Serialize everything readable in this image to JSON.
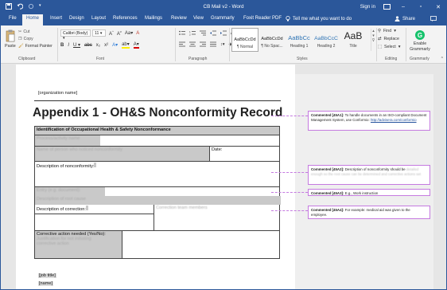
{
  "titlebar": {
    "title": "CB Mail v2  -  Word",
    "signin": "Sign in"
  },
  "tabs": [
    "File",
    "Home",
    "Insert",
    "Design",
    "Layout",
    "References",
    "Mailings",
    "Review",
    "View",
    "Grammarly",
    "Foxit Reader PDF"
  ],
  "active_tab": "Home",
  "tellme": "Tell me what you want to do",
  "share": "Share",
  "ribbon": {
    "clipboard": {
      "paste": "Paste",
      "cut": "Cut",
      "copy": "Copy",
      "format_painter": "Format Painter",
      "label": "Clipboard"
    },
    "font": {
      "name": "Calibri (Body)",
      "size": "11",
      "label": "Font"
    },
    "paragraph": {
      "label": "Paragraph"
    },
    "styles": {
      "label": "Styles",
      "items": [
        {
          "preview": "AaBbCcDd",
          "name": "¶ Normal"
        },
        {
          "preview": "AaBbCcDd",
          "name": "¶ No Spac..."
        },
        {
          "preview": "AaBbCc",
          "name": "Heading 1"
        },
        {
          "preview": "AaBbCcC",
          "name": "Heading 2"
        },
        {
          "preview": "AaB",
          "name": "Title"
        }
      ]
    },
    "editing": {
      "find": "Find",
      "replace": "Replace",
      "select": "Select",
      "label": "Editing"
    },
    "grammarly": {
      "enable": "Enable Grammarly",
      "label": "Grammarly"
    }
  },
  "document": {
    "org": "[organization name]",
    "title": "Appendix 1 - OH&S Nonconformity Record",
    "table": {
      "header": "Identification of Occupational Health & Safety Nonconformance",
      "row1_blur": "Process/activity name",
      "row2_blur": "Name of person who noticed nonconformity",
      "date": "Date:",
      "desc_nonconformity": "Description of nonconformity:",
      "blur_a": "Entry (e.g. document):",
      "blur_b": "Description of root cause",
      "desc_correction": "Description of correction:",
      "blur_c": "Correction team members",
      "corrective_action": "Corrective action needed (Yes/No):",
      "blur_d": "Justification for not initiating",
      "blur_e": "corrective action"
    },
    "job_title": "[job title]",
    "name": "[name]"
  },
  "comments": [
    {
      "id": "Commented [45A1]:",
      "text": "To handle documents in an ISO-compliant Document Management System, use Conformio:",
      "link": "http://advisera.com/conformio"
    },
    {
      "id": "Commented [45A2]:",
      "text": "Description of nonconformity should be",
      "text_blur": "detailed enough so the root cause can be determined and corrective actions set"
    },
    {
      "id": "Commented [45A3]:",
      "text": "E.g., Work instruction"
    },
    {
      "id": "Commented [45A4]:",
      "text": "For example: medical aid was given to the employee."
    }
  ]
}
